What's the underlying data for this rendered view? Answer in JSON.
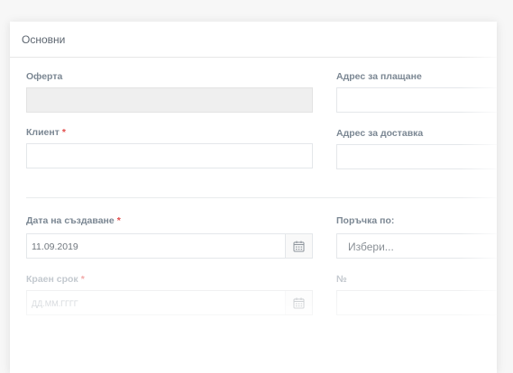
{
  "section": {
    "title": "Основни"
  },
  "fields": {
    "offer": {
      "label": "Оферта",
      "value": ""
    },
    "client": {
      "label": "Клиент",
      "required_mark": "*",
      "value": ""
    },
    "billing_address": {
      "label": "Адрес за плащане",
      "value": ""
    },
    "shipping_address": {
      "label": "Адрес за доставка",
      "value": ""
    },
    "created_date": {
      "label": "Дата на създаване",
      "required_mark": "*",
      "value": "11.09.2019"
    },
    "deadline": {
      "label": "Краен срок",
      "required_mark": "*",
      "placeholder": "ДД.ММ.ГГГГ"
    },
    "order_by": {
      "label": "Поръчка по:",
      "placeholder": "Избери..."
    },
    "number": {
      "label": "№",
      "value": ""
    }
  },
  "icons": {
    "date_picker": "calendar-icon"
  },
  "colors": {
    "required": "#e24c4b",
    "label": "#7b8793",
    "disabled_field": "#efefef"
  }
}
